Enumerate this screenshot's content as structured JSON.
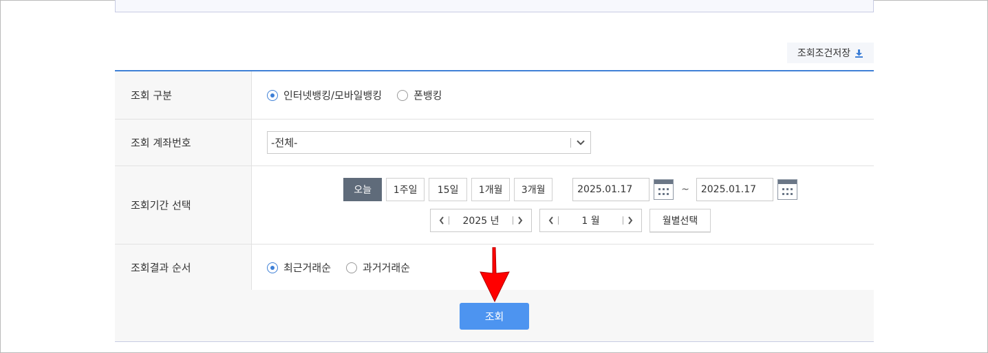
{
  "toolbar": {
    "save_conditions_label": "조회조건저장"
  },
  "rows": {
    "type": {
      "label": "조회 구분",
      "options": [
        {
          "label": "인터넷뱅킹/모바일뱅킹",
          "checked": true
        },
        {
          "label": "폰뱅킹",
          "checked": false
        }
      ]
    },
    "account": {
      "label": "조회 계좌번호",
      "selected": "-전체-"
    },
    "period": {
      "label": "조회기간 선택",
      "quick_buttons": [
        "오늘",
        "1주일",
        "15일",
        "1개월",
        "3개월"
      ],
      "active_button": "오늘",
      "start_date": "2025.01.17",
      "tilde": "~",
      "end_date": "2025.01.17",
      "year_value": "2025 년",
      "month_value": "1 월",
      "month_select_label": "월별선택"
    },
    "order": {
      "label": "조회결과 순서",
      "options": [
        {
          "label": "최근거래순",
          "checked": true
        },
        {
          "label": "과거거래순",
          "checked": false
        }
      ]
    }
  },
  "actions": {
    "search_label": "조회"
  },
  "colors": {
    "accent": "#3d7fd6",
    "search_button": "#4d94f0",
    "active_period": "#5f6b7a",
    "annotation_arrow": "#ff0000"
  },
  "icons": {
    "download": "download-icon",
    "calendar": "calendar-icon",
    "chevron": "chevron-down-icon"
  }
}
